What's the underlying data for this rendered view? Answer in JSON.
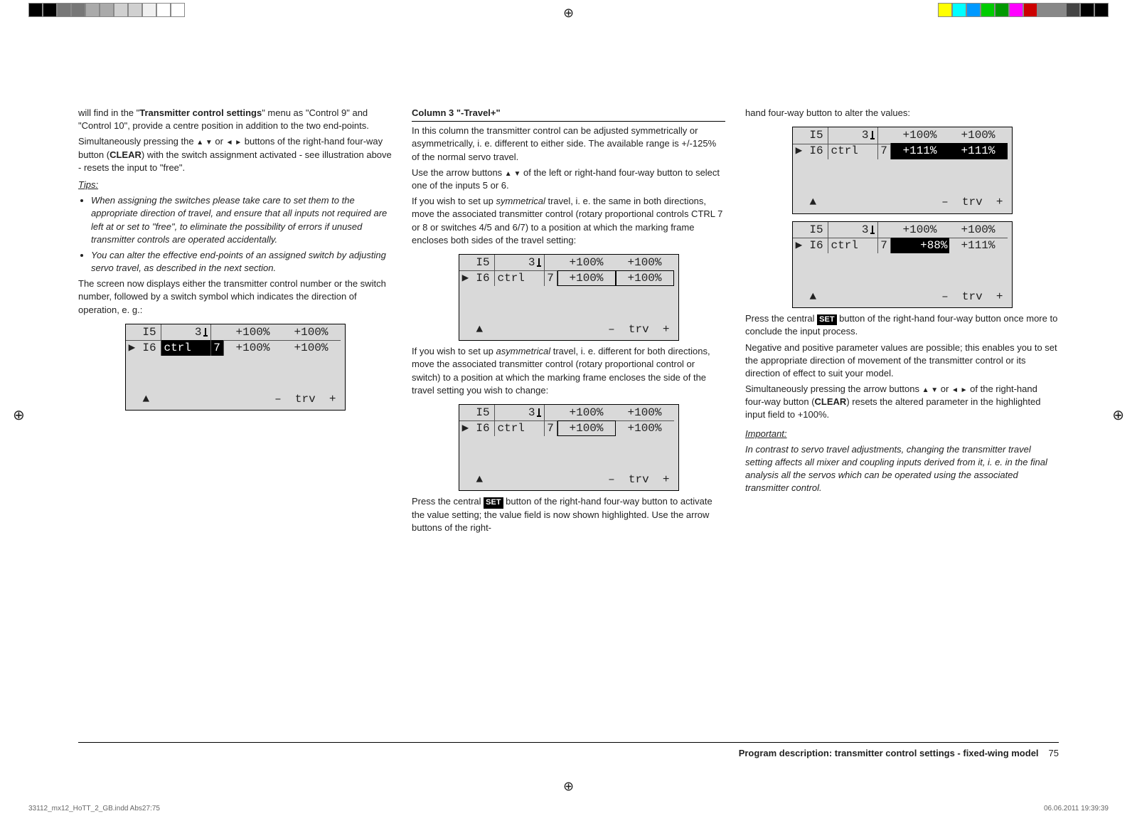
{
  "reg_colors_left": [
    "#000",
    "#000",
    "#777",
    "#777",
    "#aaa",
    "#aaa",
    "#d0d0d0",
    "#d0d0d0",
    "#f0f0f0",
    "#fff",
    "#fff"
  ],
  "reg_colors_right": [
    "#ff0",
    "#0ff",
    "#09f",
    "#0c0",
    "#090",
    "#f0f",
    "#c00",
    "#888",
    "#888",
    "#444",
    "#000",
    "#000"
  ],
  "col1": {
    "p1a": "will find in the \"",
    "p1b": "Transmitter control settings",
    "p1c": "\" menu as \"Control 9\" and \"Control 10\", provide a centre position in addition to the two end-points.",
    "p2a": "Simultaneously pressing the ",
    "p2arrows1": "▲ ▼",
    "p2or": " or ",
    "p2arrows2": "◄ ►",
    "p2b": " buttons of the right-hand four-way button (",
    "p2clear": "CLEAR",
    "p2c": ") with the switch assignment activated - see illustration above - resets the input to \"free\".",
    "tips_hd": "Tips:",
    "tip1": "When assigning the switches please take care to set them to the appropriate direction of travel, and ensure that all inputs not required are left at or set to \"free\", to eliminate the possibility of errors if unused transmitter controls are operated accidentally.",
    "tip2": "You can alter the effective end-points of an assigned switch by adjusting servo travel, as described in the next section.",
    "p3": "The screen now displays either the transmitter control number or the switch number, followed by a switch symbol which indicates the direction of operation, e. g.:"
  },
  "col2": {
    "hd": "Column 3 \"-Travel+\"",
    "p1": "In this column the transmitter control can be adjusted symmetrically or asymmetrically, i. e. different to either side. The available range is +/-125% of the normal servo travel.",
    "p2a": "Use the arrow buttons ",
    "p2arrows": "▲ ▼",
    "p2b": " of the left or right-hand four-way button to select one of the inputs 5 or 6.",
    "p3a": "If you wish to set up ",
    "p3sym": "symmetrical",
    "p3b": " travel, i. e. the same in both directions, move the associated transmitter control (rotary proportional controls CTRL 7 or 8 or switches 4/5 and 6/7) to a position at which the marking frame encloses both sides of the travel setting:",
    "p4a": "If you wish to set up ",
    "p4asym": "asymmetrical",
    "p4b": " travel, i. e. different for both directions, move the associated transmitter control (rotary proportional control or switch) to a position at which the marking frame encloses the side of the travel setting you wish to change:",
    "p5a": "Press the central ",
    "p5set": "SET",
    "p5b": " button of the right-hand four-way button to activate the value setting; the value field is now shown highlighted. Use the arrow buttons of the right-"
  },
  "col3": {
    "p1": "hand four-way button to alter the values:",
    "p2a": "Press the central ",
    "p2set": "SET",
    "p2b": " button of the right-hand four-way button once more to conclude the input process.",
    "p3": "Negative and positive parameter values are possible; this enables you to set the appropriate direction of movement of the transmitter control or its direction of effect to suit your model.",
    "p4a": "Simultaneously pressing the arrow buttons ",
    "p4arrows1": "▲ ▼",
    "p4or": " or ",
    "p4arrows2": "◄ ►",
    "p4b": " of the right-hand four-way button (",
    "p4clear": "CLEAR",
    "p4c": ") resets the altered parameter in the highlighted input field to +100%.",
    "imp_hd": "Important:",
    "imp_body": "In contrast to servo travel adjustments, changing the transmitter travel setting affects all mixer and coupling inputs derived from it, i. e. in the final analysis all the servos which can be operated using the associated transmitter control."
  },
  "lcd": {
    "top_i5": "I5",
    "top_sw": "3",
    "top_v1": "+100%",
    "top_v2": "+100%",
    "ptr": "▶",
    "row_i6": "I6",
    "row_ctrl": "ctrl",
    "row_7": "7",
    "bottom_up": "▲",
    "bottom_minus": "–",
    "bottom_trv": "trv",
    "bottom_plus": "+"
  },
  "lcd_vals": {
    "s1_v1": "+100%",
    "s1_v2": "+100%",
    "s2_v1": "+100%",
    "s2_v2": "+100%",
    "s3_v1": "+100%",
    "s3_v2": "+100%",
    "s4_v1": "+111%",
    "s4_v2": "+111%",
    "s5_v1": "+88%",
    "s5_v2": "+111%"
  },
  "footer": {
    "label": "Program description: transmitter control settings - fixed-wing model",
    "page": "75"
  },
  "print": {
    "file": "33112_mx12_HoTT_2_GB.indd   Abs27:75",
    "ts": "06.06.2011   19:39:39"
  }
}
